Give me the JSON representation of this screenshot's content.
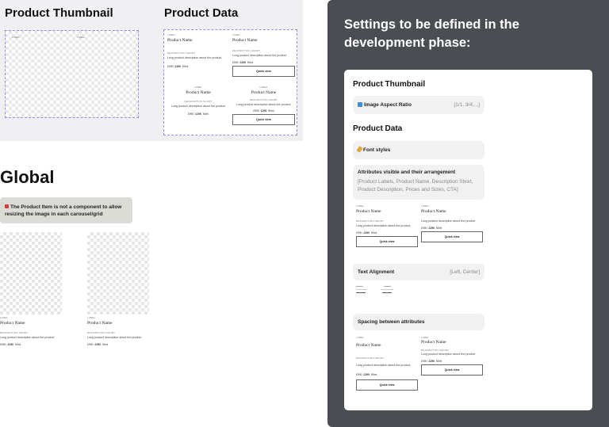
{
  "thumbnail_section": {
    "title": "Product Thumbnail",
    "label_a": "LABEL",
    "label_b": "LABEL"
  },
  "data_section": {
    "title": "Product Data"
  },
  "card": {
    "label": "LABEL",
    "name": "Product Name",
    "desc_heading": "DESCRIPTION SHORT",
    "desc": "Long product description about the product",
    "price_old": "£990",
    "price_new": "£290",
    "size": "50ml",
    "quick_view": "Quick view"
  },
  "global": {
    "title": "Global",
    "note": "The Product Item is not a component to allow resizing the image in each carousel/grid"
  },
  "settings": {
    "title": "Settings to be defined in the development phase:",
    "thumb_heading": "Product Thumbnail",
    "aspect_label": "Image Aspect Ratio",
    "aspect_value": "[1/1, 3/4,...]",
    "data_heading": "Product Data",
    "font_label": "Font styles",
    "attrs_label": "Attributes visible and their arrangement",
    "attrs_value": "[Product Labels, Product Name, Description Short, Product Description, Prices and Sizes, CTA]",
    "align_label": "Text Alignment",
    "align_value": "[Left, Center]",
    "spacing_label": "Spacing between attributes"
  },
  "colors": {
    "dark_panel": "#4a4d52",
    "gray_panel": "#f0f0f3",
    "note_bg": "#dcdcd6",
    "dashed_border": "#9b8cf0"
  }
}
